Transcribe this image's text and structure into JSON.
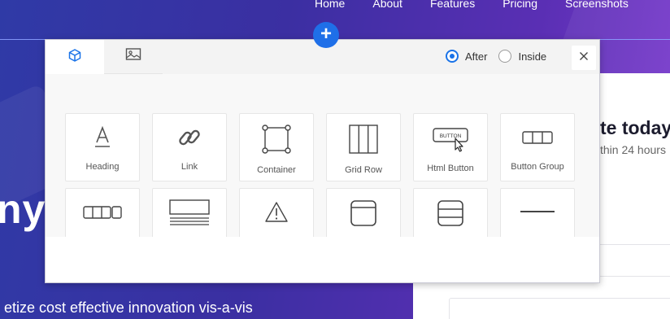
{
  "background": {
    "nav": [
      "Home",
      "About",
      "Features",
      "Pricing",
      "Screenshots"
    ],
    "hero_word": "nyt",
    "hero_sub": "etize cost effective innovation vis-a-vis",
    "card_title": "te today",
    "card_sub": "thin 24 hours"
  },
  "modal": {
    "tabs": [
      {
        "icon": "cube-icon",
        "active": true
      },
      {
        "icon": "image-icon",
        "active": false
      }
    ],
    "position_options": [
      {
        "label": "After",
        "checked": true
      },
      {
        "label": "Inside",
        "checked": false
      }
    ],
    "elements": [
      {
        "label": "Heading",
        "icon": "heading-icon"
      },
      {
        "label": "Link",
        "icon": "link-icon"
      },
      {
        "label": "Container",
        "icon": "container-icon"
      },
      {
        "label": "Grid Row",
        "icon": "grid-row-icon"
      },
      {
        "label": "Html Button",
        "icon": "html-button-icon",
        "icon_text": "BUTTON"
      },
      {
        "label": "Button Group",
        "icon": "button-group-icon"
      },
      {
        "label": "",
        "icon": "button-toolbar-icon"
      },
      {
        "label": "",
        "icon": "text-block-icon"
      },
      {
        "label": "",
        "icon": "alert-icon"
      },
      {
        "label": "",
        "icon": "panel-icon"
      },
      {
        "label": "",
        "icon": "list-group-icon"
      },
      {
        "label": "",
        "icon": "divider-icon"
      }
    ]
  },
  "colors": {
    "accent": "#1a73e8",
    "background_gradient_start": "#2f3aa6",
    "background_gradient_end": "#7d3bd0"
  }
}
